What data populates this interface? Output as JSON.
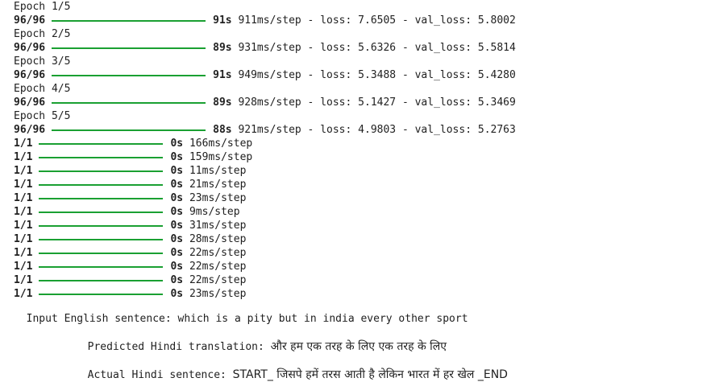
{
  "epochs": [
    {
      "header": "Epoch 1/5",
      "progress": "96/96",
      "time": "91s",
      "rest": "911ms/step - loss: 7.6505 - val_loss: 5.8002"
    },
    {
      "header": "Epoch 2/5",
      "progress": "96/96",
      "time": "89s",
      "rest": "931ms/step - loss: 5.6326 - val_loss: 5.5814"
    },
    {
      "header": "Epoch 3/5",
      "progress": "96/96",
      "time": "91s",
      "rest": "949ms/step - loss: 5.3488 - val_loss: 5.4280"
    },
    {
      "header": "Epoch 4/5",
      "progress": "96/96",
      "time": "89s",
      "rest": "928ms/step - loss: 5.1427 - val_loss: 5.3469"
    },
    {
      "header": "Epoch 5/5",
      "progress": "96/96",
      "time": "88s",
      "rest": "921ms/step - loss: 4.9803 - val_loss: 5.2763"
    }
  ],
  "predict_steps": [
    {
      "progress": "1/1",
      "time": "0s",
      "rest": "166ms/step"
    },
    {
      "progress": "1/1",
      "time": "0s",
      "rest": "159ms/step"
    },
    {
      "progress": "1/1",
      "time": "0s",
      "rest": "11ms/step"
    },
    {
      "progress": "1/1",
      "time": "0s",
      "rest": "21ms/step"
    },
    {
      "progress": "1/1",
      "time": "0s",
      "rest": "23ms/step"
    },
    {
      "progress": "1/1",
      "time": "0s",
      "rest": "9ms/step"
    },
    {
      "progress": "1/1",
      "time": "0s",
      "rest": "31ms/step"
    },
    {
      "progress": "1/1",
      "time": "0s",
      "rest": "28ms/step"
    },
    {
      "progress": "1/1",
      "time": "0s",
      "rest": "22ms/step"
    },
    {
      "progress": "1/1",
      "time": "0s",
      "rest": "22ms/step"
    },
    {
      "progress": "1/1",
      "time": "0s",
      "rest": "22ms/step"
    },
    {
      "progress": "1/1",
      "time": "0s",
      "rest": "23ms/step"
    }
  ],
  "results": {
    "input_label": "Input English sentence:",
    "input_text": "which is a pity but in india every other sport",
    "predicted_label": "Predicted Hindi translation:",
    "predicted_text": "और हम एक तरह के लिए एक तरह के लिए",
    "actual_label": "Actual Hindi sentence:",
    "actual_text": "START_ जिसपे हमें तरस आती है लेकिन भारत में हर खेल _END"
  },
  "colors": {
    "progress_bar": "#1aa032",
    "text": "#212121",
    "background": "#ffffff"
  }
}
